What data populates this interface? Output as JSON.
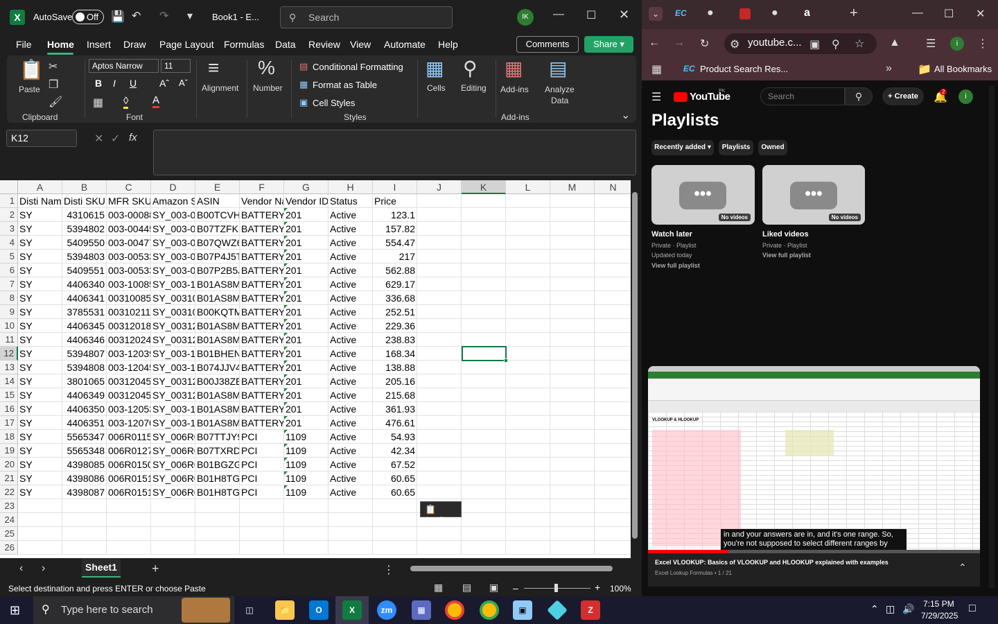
{
  "excel": {
    "autosave_label": "AutoSave",
    "autosave_state": "Off",
    "book_title": "Book1 - E...",
    "search_placeholder": "Search",
    "user_initials": "IK",
    "menu": [
      "File",
      "Home",
      "Insert",
      "Draw",
      "Page Layout",
      "Formulas",
      "Data",
      "Review",
      "View",
      "Automate",
      "Help"
    ],
    "comments_label": "Comments",
    "share_label": "Share",
    "ribbon": {
      "paste": "Paste",
      "clipboard": "Clipboard",
      "font_name": "Aptos Narrow",
      "font_size": "11",
      "font": "Font",
      "alignment": "Alignment",
      "number": "Number",
      "cond_format": "Conditional Formatting",
      "format_table": "Format as Table",
      "cell_styles": "Cell Styles",
      "styles": "Styles",
      "cells": "Cells",
      "editing": "Editing",
      "addins": "Add-ins",
      "addins_group": "Add-ins",
      "analyze": "Analyze",
      "analyze2": "Data"
    },
    "name_box": "K12",
    "columns": [
      "A",
      "B",
      "C",
      "D",
      "E",
      "F",
      "G",
      "H",
      "I",
      "J",
      "K",
      "L",
      "M",
      "N"
    ],
    "header_row": [
      "Disti Nam",
      "Disti SKU",
      "MFR SKU",
      "Amazon S",
      "ASIN",
      "Vendor Na",
      "Vendor ID",
      "Status",
      "Price"
    ],
    "rows": [
      [
        "SY",
        "4310615",
        "003-00088",
        "SY_003-00",
        "B00TCVH4",
        "BATTERY T",
        "201",
        "Active",
        "123.1"
      ],
      [
        "SY",
        "5394802",
        "003-00445",
        "SY_003-00",
        "B07TZFKP",
        "BATTERY T",
        "201",
        "Active",
        "157.82"
      ],
      [
        "SY",
        "5409550",
        "003-00477",
        "SY_003-00",
        "B07QWZ6",
        "BATTERY T",
        "201",
        "Active",
        "554.47"
      ],
      [
        "SY",
        "5394803",
        "003-00533",
        "SY_003-00",
        "B07P4J5T",
        "BATTERY T",
        "201",
        "Active",
        "217"
      ],
      [
        "SY",
        "5409551",
        "003-00533",
        "SY_003-00",
        "B07P2B5J",
        "BATTERY T",
        "201",
        "Active",
        "562.88"
      ],
      [
        "SY",
        "4406340",
        "003-10085",
        "SY_003-10",
        "B01AS8MF",
        "BATTERY T",
        "201",
        "Active",
        "629.17"
      ],
      [
        "SY",
        "4406341",
        "003100857",
        "SY_003100",
        "B01AS8MK",
        "BATTERY T",
        "201",
        "Active",
        "336.68"
      ],
      [
        "SY",
        "3785531",
        "003102119",
        "SY_003102",
        "B00KQTM",
        "BATTERY T",
        "201",
        "Active",
        "252.51"
      ],
      [
        "SY",
        "4406345",
        "003120188",
        "SY_003120",
        "B01AS8MN",
        "BATTERY T",
        "201",
        "Active",
        "229.36"
      ],
      [
        "SY",
        "4406346",
        "003120242",
        "SY_003120",
        "B01AS8MN",
        "BATTERY T",
        "201",
        "Active",
        "238.83"
      ],
      [
        "SY",
        "5394807",
        "003-12039",
        "SY_003-12",
        "B01BHENN",
        "BATTERY T",
        "201",
        "Active",
        "168.34"
      ],
      [
        "SY",
        "5394808",
        "003-12045",
        "SY_003-12",
        "B074JJV4X",
        "BATTERY T",
        "201",
        "Active",
        "138.88"
      ],
      [
        "SY",
        "3801065",
        "003120458",
        "SY_003120",
        "B00J38ZE0",
        "BATTERY T",
        "201",
        "Active",
        "205.16"
      ],
      [
        "SY",
        "4406349",
        "003120458",
        "SY_003120",
        "B01AS8MN",
        "BATTERY T",
        "201",
        "Active",
        "215.68"
      ],
      [
        "SY",
        "4406350",
        "003-12053",
        "SY_003-12",
        "B01AS8MJ",
        "BATTERY T",
        "201",
        "Active",
        "361.93"
      ],
      [
        "SY",
        "4406351",
        "003-12070",
        "SY_003-12",
        "B01AS8MJ",
        "BATTERY T",
        "201",
        "Active",
        "476.61"
      ],
      [
        "SY",
        "5565347",
        "006R0115",
        "SY_006R01",
        "B07TTJY9P",
        "PCI",
        "1109",
        "Active",
        "54.93"
      ],
      [
        "SY",
        "5565348",
        "006R0127",
        "SY_006R01",
        "B07TXRDB",
        "PCI",
        "1109",
        "Active",
        "42.34"
      ],
      [
        "SY",
        "4398085",
        "006R0150",
        "SY_006R01",
        "B01BGZGH",
        "PCI",
        "1109",
        "Active",
        "67.52"
      ],
      [
        "SY",
        "4398086",
        "006R0151",
        "SY_006R01",
        "B01H8TGD",
        "PCI",
        "1109",
        "Active",
        "60.65"
      ],
      [
        "SY",
        "4398087",
        "006R0151",
        "SY_006R01",
        "B01H8TGD",
        "PCI",
        "1109",
        "Active",
        "60.65"
      ]
    ],
    "row_numbers": [
      "1",
      "2",
      "3",
      "4",
      "5",
      "6",
      "7",
      "8",
      "9",
      "10",
      "11",
      "12",
      "13",
      "14",
      "15",
      "16",
      "17",
      "18",
      "19",
      "20",
      "21",
      "22",
      "23",
      "24",
      "25",
      "26"
    ],
    "paste_options": "(Ctrl)",
    "sheet_tab": "Sheet1",
    "status_text": "Select destination and press ENTER or choose Paste",
    "zoom": "100%"
  },
  "chrome": {
    "tab_label": "EC",
    "url": "youtube.c...",
    "bookmark": "Product Search Res...",
    "all_bookmarks": "All Bookmarks",
    "profile_initial": "i"
  },
  "youtube": {
    "logo": "YouTube",
    "region": "PK",
    "search_placeholder": "Search",
    "create_label": "Create",
    "notif_count": "2",
    "page_title": "Playlists",
    "chips": [
      "Recently added",
      "Playlists",
      "Owned"
    ],
    "playlists": [
      {
        "title": "Watch later",
        "sub1": "Private · Playlist",
        "sub2": "Updated today",
        "link": "View full playlist",
        "badge": "No videos"
      },
      {
        "title": "Liked videos",
        "sub1": "Private · Playlist",
        "sub2": "",
        "link": "View full playlist",
        "badge": "No videos"
      }
    ],
    "mini_title": "Excel VLOOKUP: Basics of VLOOKUP and HLOOKUP explained with examples",
    "mini_sub": "Excel Lookup Formulas • 1 / 21",
    "caption": "in and your answers are in, and it's one range. So, you're not supposed to select different ranges by",
    "mini_sheet_heading": "VLOOKUP & HLOOKUP"
  },
  "taskbar": {
    "search_placeholder": "Type here to search",
    "time": "7:15 PM",
    "date": "7/29/2025"
  }
}
